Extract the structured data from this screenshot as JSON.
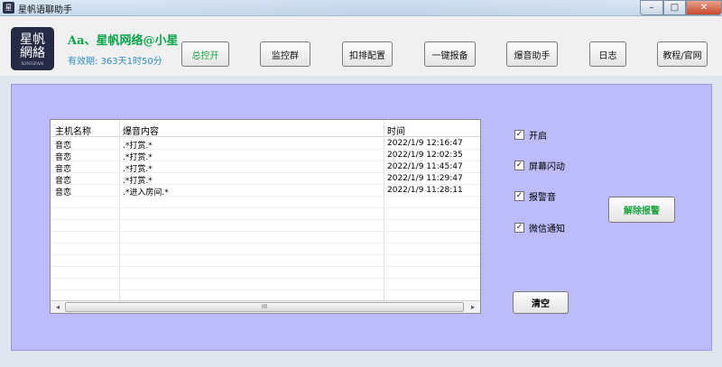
{
  "window": {
    "title": "星帆语聊助手",
    "app_icon_glyph": "星",
    "minimize_glyph": "–",
    "maximize_glyph": "□",
    "close_glyph": "✕"
  },
  "header": {
    "logo_line1": "星帆",
    "logo_line2": "網絡",
    "logo_sub": "XINGFAN",
    "user_name": "Aa、星帆网络@小星",
    "expiry": "有效期: 363天1时50分"
  },
  "toolbar": {
    "master_control": "总控开",
    "monitor_group": "监控群",
    "sort_config": "扣排配置",
    "one_click_report": "一键报备",
    "explosion_helper": "爆音助手",
    "logs": "日志",
    "tutorial": "教程/官网"
  },
  "table": {
    "headers": {
      "host": "主机名称",
      "content": "爆音内容",
      "time": "时间"
    },
    "rows": [
      {
        "host": "音恋",
        "content": ".*打赏.*",
        "time": "2022/1/9 12:16:47"
      },
      {
        "host": "音恋",
        "content": ".*打赏.*",
        "time": "2022/1/9 12:02:35"
      },
      {
        "host": "音恋",
        "content": ".*打赏.*",
        "time": "2022/1/9 11:45:47"
      },
      {
        "host": "音恋",
        "content": ".*打赏.*",
        "time": "2022/1/9 11:29:47"
      },
      {
        "host": "音恋",
        "content": ".*进入房间.*",
        "time": "2022/1/9 11:28:11"
      }
    ],
    "scroll_left": "◂",
    "scroll_right": "▸",
    "scroll_grip": "III"
  },
  "options": {
    "check_glyph": "✓",
    "enable": {
      "label": "开启",
      "checked": true
    },
    "screen_flash": {
      "label": "屏幕闪动",
      "checked": true
    },
    "alarm_sound": {
      "label": "报警音",
      "checked": true
    },
    "wechat_notify": {
      "label": "微信通知",
      "checked": true
    }
  },
  "actions": {
    "dismiss_alarm": "解除报警",
    "clear": "清空"
  },
  "colors": {
    "panel_bg": "#bdbcfa",
    "accent_green": "#19a33e",
    "expiry_blue": "#2f8fc6"
  }
}
